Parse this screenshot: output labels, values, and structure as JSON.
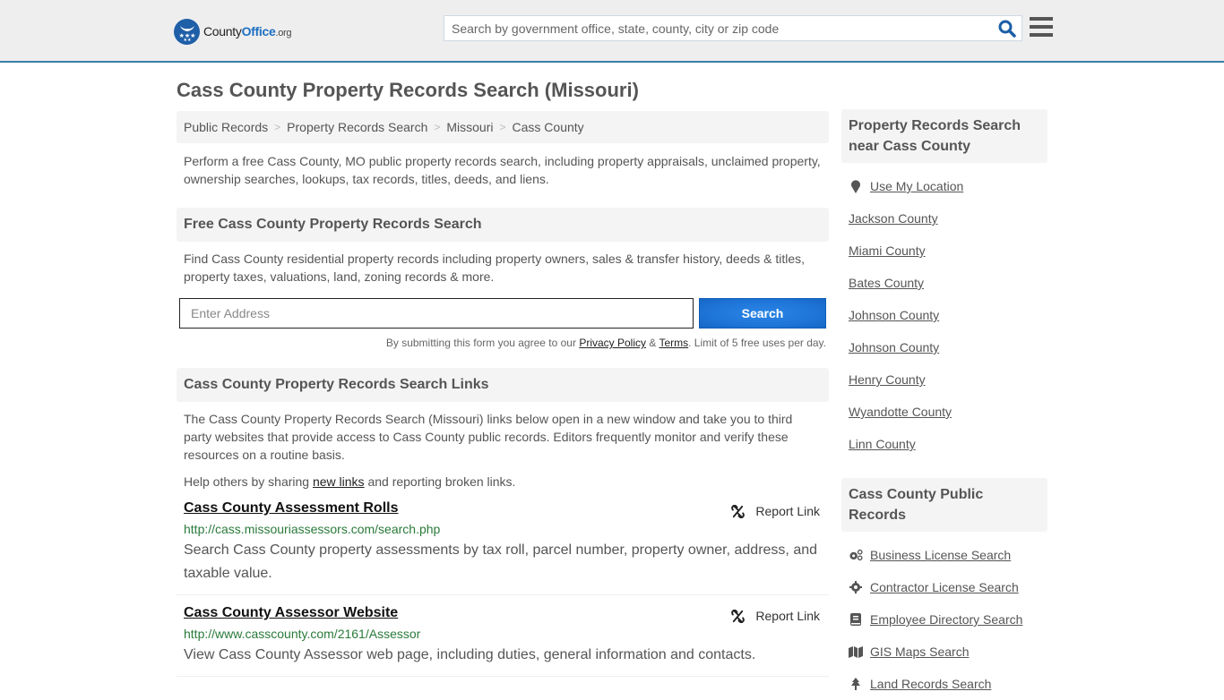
{
  "header": {
    "logo": {
      "county": "County",
      "office": "Office",
      "org": ".org"
    },
    "search_placeholder": "Search by government office, state, county, city or zip code",
    "search_icon": "search-icon",
    "menu_icon": "hamburger-menu-icon"
  },
  "page_title": "Cass County Property Records Search (Missouri)",
  "breadcrumb": [
    {
      "label": "Public Records"
    },
    {
      "label": "Property Records Search"
    },
    {
      "label": "Missouri"
    },
    {
      "label": "Cass County"
    }
  ],
  "breadcrumb_separator": ">",
  "intro": "Perform a free Cass County, MO public property records search, including property appraisals, unclaimed property, ownership searches, lookups, tax records, titles, deeds, and liens.",
  "free_search": {
    "heading": "Free Cass County Property Records Search",
    "description": "Find Cass County residential property records including property owners, sales & transfer history, deeds & titles, property taxes, valuations, land, zoning records & more.",
    "address_placeholder": "Enter Address",
    "address_value": "",
    "button_label": "Search",
    "disclaimer": {
      "prefix": "By submitting this form you agree to our ",
      "privacy_label": "Privacy Policy",
      "amp": " & ",
      "terms_label": "Terms",
      "suffix": ". Limit of 5 free uses per day."
    }
  },
  "links_section": {
    "heading": "Cass County Property Records Search Links",
    "description": "The Cass County Property Records Search (Missouri) links below open in a new window and take you to third party websites that provide access to Cass County public records. Editors frequently monitor and verify these resources on a routine basis.",
    "help": {
      "prefix": "Help others by sharing ",
      "link": "new links",
      "suffix": " and reporting broken links."
    },
    "report_label": "Report Link",
    "items": [
      {
        "title": "Cass County Assessment Rolls",
        "url": "http://cass.missouriassessors.com/search.php",
        "description": "Search Cass County property assessments by tax roll, parcel number, property owner, address, and taxable value."
      },
      {
        "title": "Cass County Assessor Website",
        "url": "http://www.casscounty.com/2161/Assessor",
        "description": "View Cass County Assessor web page, including duties, general information and contacts."
      }
    ]
  },
  "sidebar": {
    "nearby": {
      "heading": "Property Records Search near Cass County",
      "use_location": "Use My Location",
      "items": [
        "Jackson County",
        "Miami County",
        "Bates County",
        "Johnson County",
        "Johnson County",
        "Henry County",
        "Wyandotte County",
        "Linn County"
      ]
    },
    "public_records": {
      "heading": "Cass County Public Records",
      "items": [
        {
          "label": "Business License Search",
          "icon": "gears-icon"
        },
        {
          "label": "Contractor License Search",
          "icon": "gear-icon"
        },
        {
          "label": "Employee Directory Search",
          "icon": "book-icon"
        },
        {
          "label": "GIS Maps Search",
          "icon": "map-icon"
        },
        {
          "label": "Land Records Search",
          "icon": "tree-icon"
        }
      ]
    }
  }
}
